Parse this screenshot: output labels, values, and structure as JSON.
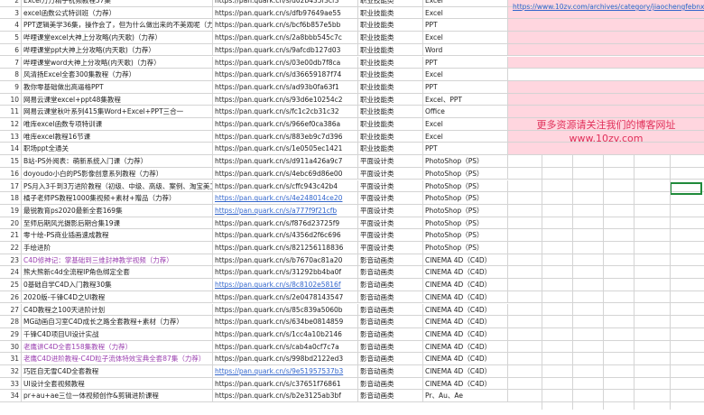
{
  "sheet": {
    "top_link": "https://www.10zv.com/archives/category/jiaochengfebnxiang",
    "banner_line1": "更多资源请关注我们的博客网址",
    "banner_line2": "www.10zv.com",
    "rows": [
      {
        "n": "2",
        "title": "Excel万万精子祝频教程57集",
        "link": "https://pan.quark.cn/s/d02b435f3cf3",
        "cat": "职业技能类",
        "sub": "Excel"
      },
      {
        "n": "3",
        "title": "excel函数公式特训班（力荐）",
        "link": "https://pan.quark.cn/s/dfb97649ae55",
        "cat": "职业技能类",
        "sub": "Excel"
      },
      {
        "n": "4",
        "title": "PPT逻辑美学36集，操作会了，但为什么做出来的不美观呢（力荐）",
        "link": "https://pan.quark.cn/s/bcf6b857e5bb",
        "cat": "职业技能类",
        "sub": "PPT"
      },
      {
        "n": "5",
        "title": "哔哩课堂excel大神上分攻略(内天歌)（力荐）",
        "link": "https://pan.quark.cn/s/2a8bbb545c7c",
        "cat": "职业技能类",
        "sub": "Excel"
      },
      {
        "n": "6",
        "title": "哔哩课堂ppt大神上分攻略(内天歌)（力荐）",
        "link": "https://pan.quark.cn/s/9afcdb127d03",
        "cat": "职业技能类",
        "sub": "Word"
      },
      {
        "n": "7",
        "title": "哔哩课堂word大神上分攻略(内天歌)（力荐）",
        "link": "https://pan.quark.cn/s/03e00db7f8ca",
        "cat": "职业技能类",
        "sub": "PPT"
      },
      {
        "n": "8",
        "title": "风清扬Excel全套300集教程（力荐）",
        "link": "https://pan.quark.cn/s/d36659187f74",
        "cat": "职业技能类",
        "sub": "Excel"
      },
      {
        "n": "9",
        "title": "教你零基础做出高逼格PPT",
        "link": "https://pan.quark.cn/s/ad93b0fa63f1",
        "cat": "职业技能类",
        "sub": "PPT"
      },
      {
        "n": "10",
        "title": "网易云课堂excel+ppt48集教程",
        "link": "https://pan.quark.cn/s/93d6e10254c2",
        "cat": "职业技能类",
        "sub": "Excel、PPT"
      },
      {
        "n": "11",
        "title": "网易云课堂秋叶系列415集Word+Excel+PPT三合一",
        "link": "https://pan.quark.cn/s/fc1c2cb31c32",
        "cat": "职业技能类",
        "sub": "Office"
      },
      {
        "n": "12",
        "title": "唯库excel函数专项特训课",
        "link": "https://pan.quark.cn/s/966ef0ca386a",
        "cat": "职业技能类",
        "sub": "Excel"
      },
      {
        "n": "13",
        "title": "唯库excel教程16节课",
        "link": "https://pan.quark.cn/s/883eb9c7d396",
        "cat": "职业技能类",
        "sub": "Excel"
      },
      {
        "n": "14",
        "title": "职场ppt全通关",
        "link": "https://pan.quark.cn/s/1e0505ec1421",
        "cat": "职业技能类",
        "sub": "PPT"
      },
      {
        "n": "15",
        "title": "B站-PS外阅表：萌新系统入门课（力荐）",
        "link": "https://pan.quark.cn/s/d911a426a9c7",
        "cat": "平面设计类",
        "sub": "PhotoShop（PS）"
      },
      {
        "n": "16",
        "title": "doyoudo小白的PS影像创意系列教程（力荐）",
        "link": "https://pan.quark.cn/s/4ebc69d86e00",
        "cat": "平面设计类",
        "sub": "PhotoShop（PS）"
      },
      {
        "n": "17",
        "title": "PS月入3千到3万进阶教程（初级、中级、高级、案例、淘宝美工",
        "link": "https://pan.quark.cn/s/cffc943c42b4",
        "cat": "平面设计类",
        "sub": "PhotoShop（PS）"
      },
      {
        "n": "18",
        "title": "橘子老师PS教程1000集视频+素材+赠品（力荐）",
        "link": "https://pan.quark.cn/s/4e248014ce20",
        "cat": "平面设计类",
        "sub": "PhotoShop（PS）",
        "blue": true
      },
      {
        "n": "19",
        "title": "最锐教育ps2020最新全套169集",
        "link": "https://pan.quark.cn/s/a777f9f21cfb",
        "cat": "平面设计类",
        "sub": "PhotoShop（PS）",
        "blue": true
      },
      {
        "n": "20",
        "title": "至师后期风光摄影后期合集19课",
        "link": "https://pan.quark.cn/s/f876d23725f9",
        "cat": "平面设计类",
        "sub": "PhotoShop（PS）"
      },
      {
        "n": "21",
        "title": "零十绘-PS商业插画速成教程",
        "link": "https://pan.quark.cn/s/4356d2f6c696",
        "cat": "平面设计类",
        "sub": "PhotoShop（PS）"
      },
      {
        "n": "22",
        "title": "手绘进阶",
        "link": "https://pan.quark.cn/s/821256118836",
        "cat": "平面设计类",
        "sub": "PhotoShop（PS）"
      },
      {
        "n": "23",
        "title": "C4D修神记：掌基础到三维封神教学视频（力荐）",
        "link": "https://pan.quark.cn/s/b7670ac81a20",
        "cat": "影音动画类",
        "sub": "CINEMA 4D（C4D）",
        "promo": true
      },
      {
        "n": "24",
        "title": "熊大熊新c4d全流程IP角色绑定全套",
        "link": "https://pan.quark.cn/s/31292bb4ba0f",
        "cat": "影音动画类",
        "sub": "CINEMA 4D（C4D）"
      },
      {
        "n": "25",
        "title": "0基础自学C4D入门教程30集",
        "link": "https://pan.quark.cn/s/8c8102e5816f",
        "cat": "影音动画类",
        "sub": "CINEMA 4D（C4D）",
        "blue": true
      },
      {
        "n": "26",
        "title": "2020版-千锋C4D之UI教程",
        "link": "https://pan.quark.cn/s/2e0478143547",
        "cat": "影音动画类",
        "sub": "CINEMA 4D（C4D）"
      },
      {
        "n": "27",
        "title": "C4D教程之100天进阶计划",
        "link": "https://pan.quark.cn/s/85c839a5060b",
        "cat": "影音动画类",
        "sub": "CINEMA 4D（C4D）"
      },
      {
        "n": "28",
        "title": "MG动画自习室C4D成长之路全套教程+素材（力荐）",
        "link": "https://pan.quark.cn/s/634be0814859",
        "cat": "影音动画类",
        "sub": "CINEMA 4D（C4D）"
      },
      {
        "n": "29",
        "title": "千锋C4D项目UI设计实战",
        "link": "https://pan.quark.cn/s/1cc4a10b2146",
        "cat": "影音动画类",
        "sub": "CINEMA 4D（C4D）"
      },
      {
        "n": "30",
        "title": "老鹰讲C4D全套158集教程（力荐）",
        "link": "https://pan.quark.cn/s/cab4a0cf7c7a",
        "cat": "影音动画类",
        "sub": "CINEMA 4D（C4D）",
        "promo": true
      },
      {
        "n": "31",
        "title": "老鹰C4D进阶教程-C4D粒子流体特效宝典全套87集（力荐）",
        "link": "https://pan.quark.cn/s/998bd2122ed3",
        "cat": "影音动画类",
        "sub": "CINEMA 4D（C4D）",
        "promo": true
      },
      {
        "n": "32",
        "title": "巧匠自无雪C4D全套教程",
        "link": "https://pan.quark.cn/s/9e51957537b3",
        "cat": "影音动画类",
        "sub": "CINEMA 4D（C4D）",
        "blue": true
      },
      {
        "n": "33",
        "title": "UI设计全套视频教程",
        "link": "https://pan.quark.cn/s/c37651f76861",
        "cat": "影音动画类",
        "sub": "CINEMA 4D（C4D）"
      },
      {
        "n": "34",
        "title": "pr+au+ae三位一体视频创作&剪辑进阶课程",
        "link": "https://pan.quark.cn/s/b2e3125ab3bf",
        "cat": "影音动画类",
        "sub": "Pr、Au、Ae"
      }
    ]
  }
}
